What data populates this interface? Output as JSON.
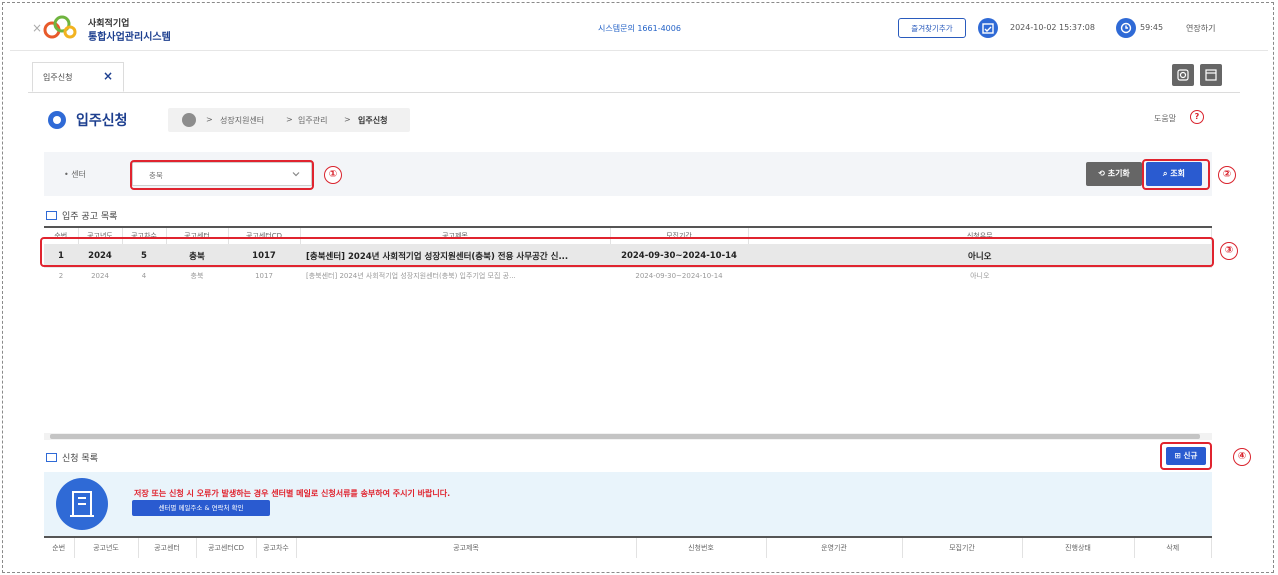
{
  "header": {
    "logo_line1": "사회적기업",
    "logo_line2": "통합사업관리시스템",
    "support": "시스템문의 1661-4006",
    "favorite_btn": "즐겨찾기추가",
    "datetime": "2024-10-02 15:37:08",
    "timer": "59:45",
    "extend": "연장하기"
  },
  "tab": {
    "label": "입주신청",
    "close": "×"
  },
  "page": {
    "title": "입주신청",
    "breadcrumb": [
      "성장지원센터",
      "입주관리",
      "입주신청"
    ],
    "help": "도움말",
    "help_icon": "?"
  },
  "search": {
    "center_label": "• 센터",
    "center_value": "충북",
    "reset": "초기화",
    "search": "조회"
  },
  "markers": [
    "①",
    "②",
    "③",
    "④"
  ],
  "notice_list": {
    "title": "입주 공고 목록",
    "columns": [
      "순번",
      "공고년도",
      "공고차수",
      "공고센터",
      "공고센터CD",
      "공고제목",
      "모집기간",
      "신청유무"
    ],
    "rows": [
      [
        "1",
        "2024",
        "5",
        "충북",
        "1017",
        "[충북센터] 2024년 사회적기업 성장지원센터(충북) 전용 사무공간 신...",
        "2024-09-30~2024-10-14",
        "아니오"
      ],
      [
        "2",
        "2024",
        "4",
        "충북",
        "1017",
        "[충북센터] 2024년 사회적기업 성장지원센터(충북) 입주기업 모집 공...",
        "2024-09-30~2024-10-14",
        "아니오"
      ]
    ]
  },
  "application_list": {
    "title": "신청 목록",
    "new_btn": "신규",
    "notice_text": "저장 또는 신청 시 오류가 발생하는 경우 센터별 메일로 신청서류를 송부하여 주시기 바랍니다.",
    "notice_btn": "센터별 메일주소 & 연락처 확인",
    "columns": [
      "순번",
      "공고년도",
      "공고센터",
      "공고센터CD",
      "공고차수",
      "공고제목",
      "신청번호",
      "운영기관",
      "모집기간",
      "진행상태",
      "삭제"
    ]
  }
}
